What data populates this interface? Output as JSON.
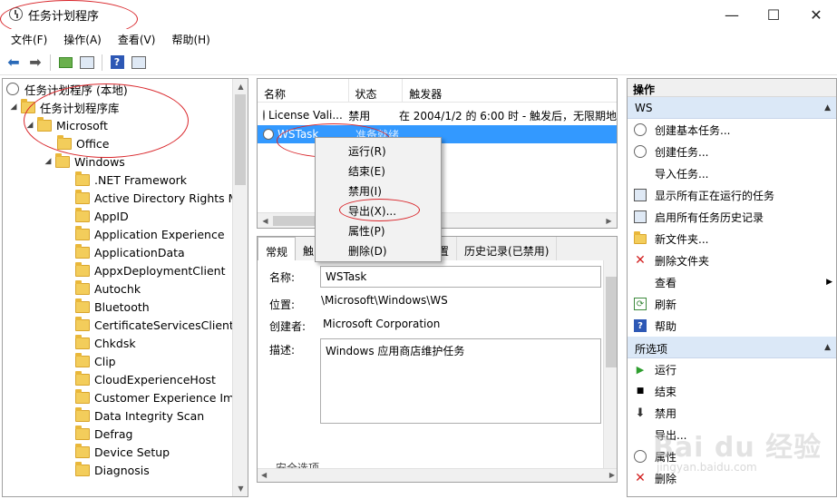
{
  "window": {
    "title": "任务计划程序",
    "min_symbol": "—",
    "max_symbol": "☐",
    "close_symbol": "✕"
  },
  "menu": [
    "文件(F)",
    "操作(A)",
    "查看(V)",
    "帮助(H)"
  ],
  "tree": {
    "root": "任务计划程序 (本地)",
    "library": "任务计划程序库",
    "microsoft": "Microsoft",
    "office": "Office",
    "windows": "Windows",
    "children": [
      ".NET Framework",
      "Active Directory Rights Ma",
      "AppID",
      "Application Experience",
      "ApplicationData",
      "AppxDeploymentClient",
      "Autochk",
      "Bluetooth",
      "CertificateServicesClient",
      "Chkdsk",
      "Clip",
      "CloudExperienceHost",
      "Customer Experience Impr",
      "Data Integrity Scan",
      "Defrag",
      "Device Setup",
      "Diagnosis"
    ]
  },
  "task_list": {
    "columns": [
      "名称",
      "状态",
      "触发器"
    ],
    "rows": [
      {
        "name": "License Vali...",
        "status": "禁用",
        "trigger": "在 2004/1/2 的 6:00 时 - 触发后，无限期地"
      },
      {
        "name": "WSTask",
        "status": "准备就绪",
        "trigger": ""
      }
    ]
  },
  "context_menu": [
    "运行(R)",
    "结束(E)",
    "禁用(I)",
    "导出(X)...",
    "属性(P)",
    "删除(D)"
  ],
  "detail": {
    "tabs": [
      "常规",
      "触",
      "设置",
      "历史记录(已禁用)"
    ],
    "name_label": "名称:",
    "name_value": "WSTask",
    "location_label": "位置:",
    "location_value": "\\Microsoft\\Windows\\WS",
    "author_label": "创建者:",
    "author_value": "Microsoft Corporation",
    "desc_label": "描述:",
    "desc_value": "Windows 应用商店维护任务",
    "security_label": "安全选项"
  },
  "actions": {
    "header": "操作",
    "section1": "WS",
    "items1": [
      "创建基本任务...",
      "创建任务...",
      "导入任务...",
      "显示所有正在运行的任务",
      "启用所有任务历史记录",
      "新文件夹...",
      "删除文件夹",
      "查看",
      "刷新",
      "帮助"
    ],
    "section2": "所选项",
    "items2": [
      "运行",
      "结束",
      "禁用",
      "导出...",
      "属性",
      "删除"
    ]
  },
  "watermark": {
    "main": "Bai du 经验",
    "sub": "jingyan.baidu.com"
  },
  "colors": {
    "selection": "#3399ff",
    "annotation": "#d9262b",
    "section_bg": "#dbe8f7"
  }
}
